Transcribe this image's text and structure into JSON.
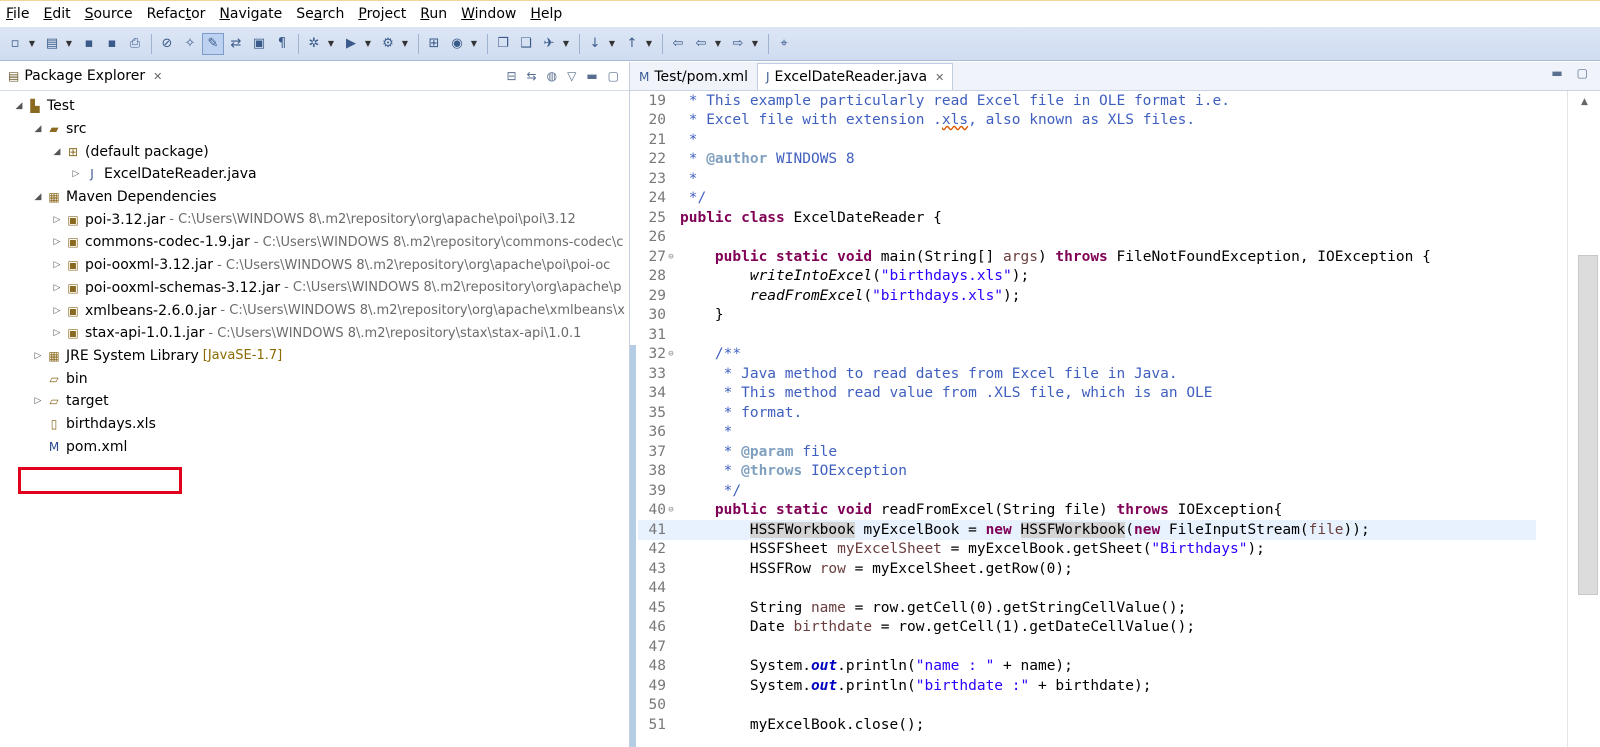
{
  "menu": [
    {
      "pre": "",
      "u": "F",
      "post": "ile"
    },
    {
      "pre": "",
      "u": "E",
      "post": "dit"
    },
    {
      "pre": "",
      "u": "S",
      "post": "ource"
    },
    {
      "pre": "Refac",
      "u": "t",
      "post": "or"
    },
    {
      "pre": "",
      "u": "N",
      "post": "avigate"
    },
    {
      "pre": "Se",
      "u": "a",
      "post": "rch"
    },
    {
      "pre": "",
      "u": "P",
      "post": "roject"
    },
    {
      "pre": "",
      "u": "R",
      "post": "un"
    },
    {
      "pre": "",
      "u": "W",
      "post": "indow"
    },
    {
      "pre": "",
      "u": "H",
      "post": "elp"
    }
  ],
  "toolbar": {
    "buttons": [
      {
        "name": "new-icon",
        "glyph": "▫",
        "drop": true
      },
      {
        "name": "new-window-icon",
        "glyph": "▤",
        "drop": true
      },
      {
        "name": "save-icon",
        "glyph": "▪",
        "drop": false
      },
      {
        "name": "save-all-icon",
        "glyph": "▪",
        "drop": false
      },
      {
        "name": "print-icon",
        "glyph": "⎙",
        "drop": false,
        "sep": true
      },
      {
        "name": "skip-breakpoints-icon",
        "glyph": "⊘",
        "drop": false
      },
      {
        "name": "open-type-icon",
        "glyph": "✧",
        "drop": false
      },
      {
        "name": "mark-occurrences-icon",
        "glyph": "✎",
        "drop": false,
        "active": true
      },
      {
        "name": "toggle-block-icon",
        "glyph": "⇄",
        "drop": false
      },
      {
        "name": "show-whitespace-icon",
        "glyph": "▣",
        "drop": false
      },
      {
        "name": "paragraph-icon",
        "glyph": "¶",
        "drop": false,
        "sep": true
      },
      {
        "name": "debug-icon",
        "glyph": "✲",
        "drop": true
      },
      {
        "name": "run-icon",
        "glyph": "▶",
        "drop": true
      },
      {
        "name": "external-tools-icon",
        "glyph": "⚙",
        "drop": true,
        "sep": true
      },
      {
        "name": "new-java-project-icon",
        "glyph": "⊞",
        "drop": false
      },
      {
        "name": "new-class-icon",
        "glyph": "◉",
        "drop": true,
        "sep": true
      },
      {
        "name": "open-folder-icon",
        "glyph": "❐",
        "drop": false
      },
      {
        "name": "open-resource-icon",
        "glyph": "❑",
        "drop": false
      },
      {
        "name": "search-icon",
        "glyph": "✈",
        "drop": true,
        "sep": true
      },
      {
        "name": "next-annotation-icon",
        "glyph": "↓",
        "drop": true
      },
      {
        "name": "previous-annotation-icon",
        "glyph": "↑",
        "drop": true,
        "sep": true
      },
      {
        "name": "last-edit-icon",
        "glyph": "⇦",
        "drop": false
      },
      {
        "name": "back-icon",
        "glyph": "⇦",
        "drop": true
      },
      {
        "name": "forward-icon",
        "glyph": "⇨",
        "drop": true,
        "sep": true
      },
      {
        "name": "pin-editor-icon",
        "glyph": "⌖",
        "drop": false
      }
    ]
  },
  "package_explorer": {
    "title": "Package Explorer",
    "tree": [
      {
        "depth": 0,
        "twisty": "◢",
        "icon": "project-icon",
        "glyph": "▙",
        "label": "Test"
      },
      {
        "depth": 1,
        "twisty": "◢",
        "icon": "source-folder-icon",
        "glyph": "▰",
        "label": "src"
      },
      {
        "depth": 2,
        "twisty": "◢",
        "icon": "package-icon",
        "glyph": "⊞",
        "label": "(default package)"
      },
      {
        "depth": 3,
        "twisty": "▷",
        "icon": "java-file-icon",
        "glyph": "J",
        "label": "ExcelDateReader.java"
      },
      {
        "depth": 1,
        "twisty": "◢",
        "icon": "library-icon",
        "glyph": "▦",
        "label": "Maven Dependencies"
      },
      {
        "depth": 2,
        "twisty": "▷",
        "icon": "jar-icon",
        "glyph": "▣",
        "label": "poi-3.12.jar",
        "path": "- C:\\Users\\WINDOWS 8\\.m2\\repository\\org\\apache\\poi\\poi\\3.12"
      },
      {
        "depth": 2,
        "twisty": "▷",
        "icon": "jar-icon",
        "glyph": "▣",
        "label": "commons-codec-1.9.jar",
        "path": "- C:\\Users\\WINDOWS 8\\.m2\\repository\\commons-codec\\c"
      },
      {
        "depth": 2,
        "twisty": "▷",
        "icon": "jar-icon",
        "glyph": "▣",
        "label": "poi-ooxml-3.12.jar",
        "path": "- C:\\Users\\WINDOWS 8\\.m2\\repository\\org\\apache\\poi\\poi-oc"
      },
      {
        "depth": 2,
        "twisty": "▷",
        "icon": "jar-icon",
        "glyph": "▣",
        "label": "poi-ooxml-schemas-3.12.jar",
        "path": "- C:\\Users\\WINDOWS 8\\.m2\\repository\\org\\apache\\p"
      },
      {
        "depth": 2,
        "twisty": "▷",
        "icon": "jar-icon",
        "glyph": "▣",
        "label": "xmlbeans-2.6.0.jar",
        "path": "- C:\\Users\\WINDOWS 8\\.m2\\repository\\org\\apache\\xmlbeans\\x"
      },
      {
        "depth": 2,
        "twisty": "▷",
        "icon": "jar-icon",
        "glyph": "▣",
        "label": "stax-api-1.0.1.jar",
        "path": "- C:\\Users\\WINDOWS 8\\.m2\\repository\\stax\\stax-api\\1.0.1"
      },
      {
        "depth": 1,
        "twisty": "▷",
        "icon": "library-icon",
        "glyph": "▦",
        "label": "JRE System Library",
        "deco": "[JavaSE-1.7]"
      },
      {
        "depth": 1,
        "twisty": "",
        "icon": "folder-icon",
        "glyph": "▱",
        "label": "bin"
      },
      {
        "depth": 1,
        "twisty": "▷",
        "icon": "folder-icon",
        "glyph": "▱",
        "label": "target"
      },
      {
        "depth": 1,
        "twisty": "",
        "icon": "file-icon",
        "glyph": "▯",
        "label": "birthdays.xls"
      },
      {
        "depth": 1,
        "twisty": "",
        "icon": "maven-pom-icon",
        "glyph": "M",
        "label": "pom.xml"
      }
    ]
  },
  "editor": {
    "tabs": [
      {
        "label": "Test/pom.xml",
        "glyph": "M",
        "active": false
      },
      {
        "label": "ExcelDateReader.java",
        "glyph": "J",
        "active": true
      }
    ],
    "current_line": "41",
    "lines": [
      {
        "n": "19",
        "t": [
          {
            "c": "jd",
            "s": " * This example particularly read Excel file in OLE format i.e."
          }
        ]
      },
      {
        "n": "20",
        "t": [
          {
            "c": "jd",
            "s": " * Excel file with extension ."
          },
          {
            "c": "jd squig",
            "s": "xls"
          },
          {
            "c": "jd",
            "s": ", also known as XLS files."
          }
        ]
      },
      {
        "n": "21",
        "t": [
          {
            "c": "jd",
            "s": " *"
          }
        ]
      },
      {
        "n": "22",
        "t": [
          {
            "c": "jd",
            "s": " * "
          },
          {
            "c": "jdtag",
            "s": "@author"
          },
          {
            "c": "jd",
            "s": " WINDOWS 8"
          }
        ]
      },
      {
        "n": "23",
        "t": [
          {
            "c": "jd",
            "s": " *"
          }
        ]
      },
      {
        "n": "24",
        "t": [
          {
            "c": "jd",
            "s": " */"
          }
        ]
      },
      {
        "n": "25",
        "t": [
          {
            "c": "kw",
            "s": "public class"
          },
          {
            "c": "",
            "s": " ExcelDateReader {"
          }
        ]
      },
      {
        "n": "26",
        "t": []
      },
      {
        "n": "27",
        "fold": true,
        "t": [
          {
            "c": "",
            "s": "    "
          },
          {
            "c": "kw",
            "s": "public static void"
          },
          {
            "c": "",
            "s": " main(String[] "
          },
          {
            "c": "param",
            "s": "args"
          },
          {
            "c": "",
            "s": ") "
          },
          {
            "c": "kw",
            "s": "throws"
          },
          {
            "c": "",
            "s": " FileNotFoundException, IOException {"
          }
        ]
      },
      {
        "n": "28",
        "t": [
          {
            "c": "",
            "s": "        "
          },
          {
            "c": "ital",
            "s": "writeIntoExcel"
          },
          {
            "c": "",
            "s": "("
          },
          {
            "c": "str",
            "s": "\"birthdays.xls\""
          },
          {
            "c": "",
            "s": ");"
          }
        ]
      },
      {
        "n": "29",
        "t": [
          {
            "c": "",
            "s": "        "
          },
          {
            "c": "ital",
            "s": "readFromExcel"
          },
          {
            "c": "",
            "s": "("
          },
          {
            "c": "str",
            "s": "\"birthdays.xls\""
          },
          {
            "c": "",
            "s": ");"
          }
        ]
      },
      {
        "n": "30",
        "t": [
          {
            "c": "",
            "s": "    }"
          }
        ]
      },
      {
        "n": "31",
        "t": []
      },
      {
        "n": "32",
        "fold": true,
        "t": [
          {
            "c": "jd",
            "s": "    /**"
          }
        ]
      },
      {
        "n": "33",
        "t": [
          {
            "c": "jd",
            "s": "     * Java method to read dates from Excel file in Java."
          }
        ]
      },
      {
        "n": "34",
        "t": [
          {
            "c": "jd",
            "s": "     * This method read value from .XLS file, which is an OLE"
          }
        ]
      },
      {
        "n": "35",
        "t": [
          {
            "c": "jd",
            "s": "     * format."
          }
        ]
      },
      {
        "n": "36",
        "t": [
          {
            "c": "jd",
            "s": "     *"
          }
        ]
      },
      {
        "n": "37",
        "t": [
          {
            "c": "jd",
            "s": "     * "
          },
          {
            "c": "jdtag",
            "s": "@param"
          },
          {
            "c": "jd",
            "s": " file"
          }
        ]
      },
      {
        "n": "38",
        "t": [
          {
            "c": "jd",
            "s": "     * "
          },
          {
            "c": "jdtag",
            "s": "@throws"
          },
          {
            "c": "jd",
            "s": " IOException"
          }
        ]
      },
      {
        "n": "39",
        "t": [
          {
            "c": "jd",
            "s": "     */"
          }
        ]
      },
      {
        "n": "40",
        "fold": true,
        "t": [
          {
            "c": "",
            "s": "    "
          },
          {
            "c": "kw",
            "s": "public static void"
          },
          {
            "c": "",
            "s": " readFromExcel(String file) "
          },
          {
            "c": "kw",
            "s": "throws"
          },
          {
            "c": "",
            "s": " IOException{"
          }
        ]
      },
      {
        "n": "41",
        "t": [
          {
            "c": "",
            "s": "        "
          },
          {
            "c": "mark-occ",
            "s": "HSSFWorkbook"
          },
          {
            "c": "",
            "s": " myExcelBook = "
          },
          {
            "c": "kw",
            "s": "new"
          },
          {
            "c": "",
            "s": " "
          },
          {
            "c": "mark-occ",
            "s": "HSSFWorkbook"
          },
          {
            "c": "",
            "s": "("
          },
          {
            "c": "kw",
            "s": "new"
          },
          {
            "c": "",
            "s": " FileInputStream("
          },
          {
            "c": "param",
            "s": "file"
          },
          {
            "c": "",
            "s": "));"
          }
        ]
      },
      {
        "n": "42",
        "t": [
          {
            "c": "",
            "s": "        HSSFSheet "
          },
          {
            "c": "param",
            "s": "myExcelSheet"
          },
          {
            "c": "",
            "s": " = myExcelBook.getSheet("
          },
          {
            "c": "str",
            "s": "\"Birthdays\""
          },
          {
            "c": "",
            "s": ");"
          }
        ]
      },
      {
        "n": "43",
        "t": [
          {
            "c": "",
            "s": "        HSSFRow "
          },
          {
            "c": "param",
            "s": "row"
          },
          {
            "c": "",
            "s": " = myExcelSheet.getRow(0);"
          }
        ]
      },
      {
        "n": "44",
        "t": []
      },
      {
        "n": "45",
        "t": [
          {
            "c": "",
            "s": "        String "
          },
          {
            "c": "param",
            "s": "name"
          },
          {
            "c": "",
            "s": " = row.getCell(0).getStringCellValue();"
          }
        ]
      },
      {
        "n": "46",
        "t": [
          {
            "c": "",
            "s": "        Date "
          },
          {
            "c": "param",
            "s": "birthdate"
          },
          {
            "c": "",
            "s": " = row.getCell(1).getDateCellValue();"
          }
        ]
      },
      {
        "n": "47",
        "t": []
      },
      {
        "n": "48",
        "t": [
          {
            "c": "",
            "s": "        System."
          },
          {
            "c": "field",
            "s": "out"
          },
          {
            "c": "",
            "s": ".println("
          },
          {
            "c": "str",
            "s": "\"name : \""
          },
          {
            "c": "",
            "s": " + name);"
          }
        ]
      },
      {
        "n": "49",
        "t": [
          {
            "c": "",
            "s": "        System."
          },
          {
            "c": "field",
            "s": "out"
          },
          {
            "c": "",
            "s": ".println("
          },
          {
            "c": "str",
            "s": "\"birthdate :\""
          },
          {
            "c": "",
            "s": " + birthdate);"
          }
        ]
      },
      {
        "n": "50",
        "t": []
      },
      {
        "n": "51",
        "t": [
          {
            "c": "",
            "s": "        myExcelBook.close();"
          }
        ]
      }
    ]
  },
  "colors": {
    "keyword": "#7f0055",
    "javadoc": "#3f5fbf",
    "string": "#2a00ff",
    "highlight_box": "#e0001b",
    "current_line": "#e8f2fe"
  }
}
